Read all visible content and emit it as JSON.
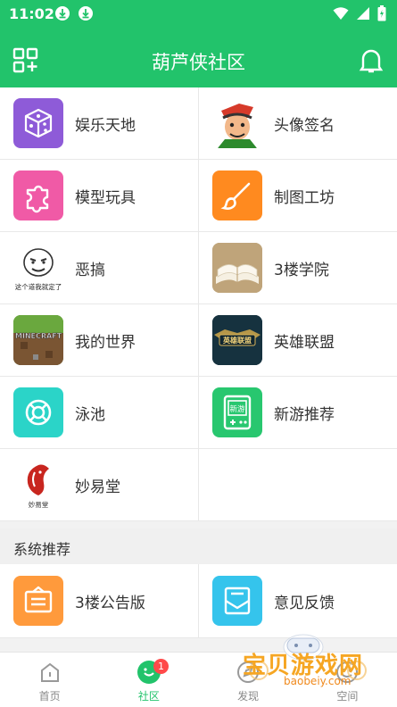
{
  "status": {
    "time": "11:02"
  },
  "header": {
    "title": "葫芦侠社区"
  },
  "categories": [
    {
      "label": "娱乐天地",
      "icon": "dice-icon",
      "color": "#8e5bd8"
    },
    {
      "label": "头像签名",
      "icon": "cartoon-avatar-icon",
      "color": "#ffffff"
    },
    {
      "label": "模型玩具",
      "icon": "puzzle-icon",
      "color": "#f05aa6"
    },
    {
      "label": "制图工坊",
      "icon": "paint-brush-icon",
      "color": "#ff8a1f"
    },
    {
      "label": "恶搞",
      "icon": "meme-face-icon",
      "color": "#ffffff",
      "caption": "这个道我就定了"
    },
    {
      "label": "3楼学院",
      "icon": "open-book-icon",
      "color": "#c7b08a"
    },
    {
      "label": "我的世界",
      "icon": "minecraft-icon",
      "color": "#5c8a3a",
      "caption": "MINECRAFT"
    },
    {
      "label": "英雄联盟",
      "icon": "league-of-legends-icon",
      "color": "#1b3b4a",
      "caption": "英雄联盟"
    },
    {
      "label": "泳池",
      "icon": "lifebuoy-icon",
      "color": "#2bd4c8"
    },
    {
      "label": "新游推荐",
      "icon": "new-game-icon",
      "color": "#28c76f",
      "caption": "新游"
    },
    {
      "label": "妙易堂",
      "icon": "koi-fish-icon",
      "color": "#ffffff",
      "caption": "妙易堂"
    }
  ],
  "section": {
    "title": "系统推荐"
  },
  "system_items": [
    {
      "label": "3楼公告版",
      "icon": "notice-board-icon",
      "color": "#ff9a3c"
    },
    {
      "label": "意见反馈",
      "icon": "feedback-mail-icon",
      "color": "#35c4ec"
    }
  ],
  "tabs": [
    {
      "label": "首页",
      "icon": "home-icon"
    },
    {
      "label": "社区",
      "icon": "community-icon",
      "badge": "1",
      "active": true
    },
    {
      "label": "发现",
      "icon": "discover-icon"
    },
    {
      "label": "空间",
      "icon": "space-icon"
    }
  ],
  "watermark": {
    "text": "宝贝游戏网",
    "url": "baobeiy.com"
  }
}
